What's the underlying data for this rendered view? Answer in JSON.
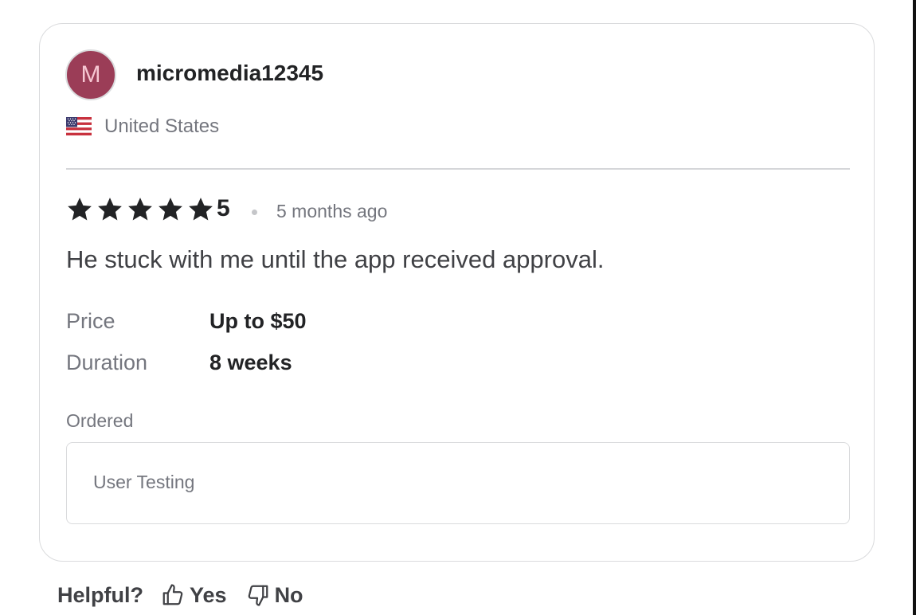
{
  "reviewer": {
    "avatar_initial": "M",
    "username": "micromedia12345",
    "country": "United States",
    "flag_icon": "us-flag-icon"
  },
  "review": {
    "rating": "5",
    "stars": 5,
    "time_ago": "5 months ago",
    "text": "He stuck with me until the app received approval."
  },
  "details": {
    "price_label": "Price",
    "price_value": "Up to $50",
    "duration_label": "Duration",
    "duration_value": "8 weeks"
  },
  "ordered": {
    "label": "Ordered",
    "item": "User Testing"
  },
  "helpful": {
    "label": "Helpful?",
    "yes_label": "Yes",
    "no_label": "No"
  },
  "colors": {
    "avatar_bg": "#9b3d57",
    "text_primary": "#222325",
    "text_secondary": "#74767e",
    "border": "#dadbdd"
  }
}
